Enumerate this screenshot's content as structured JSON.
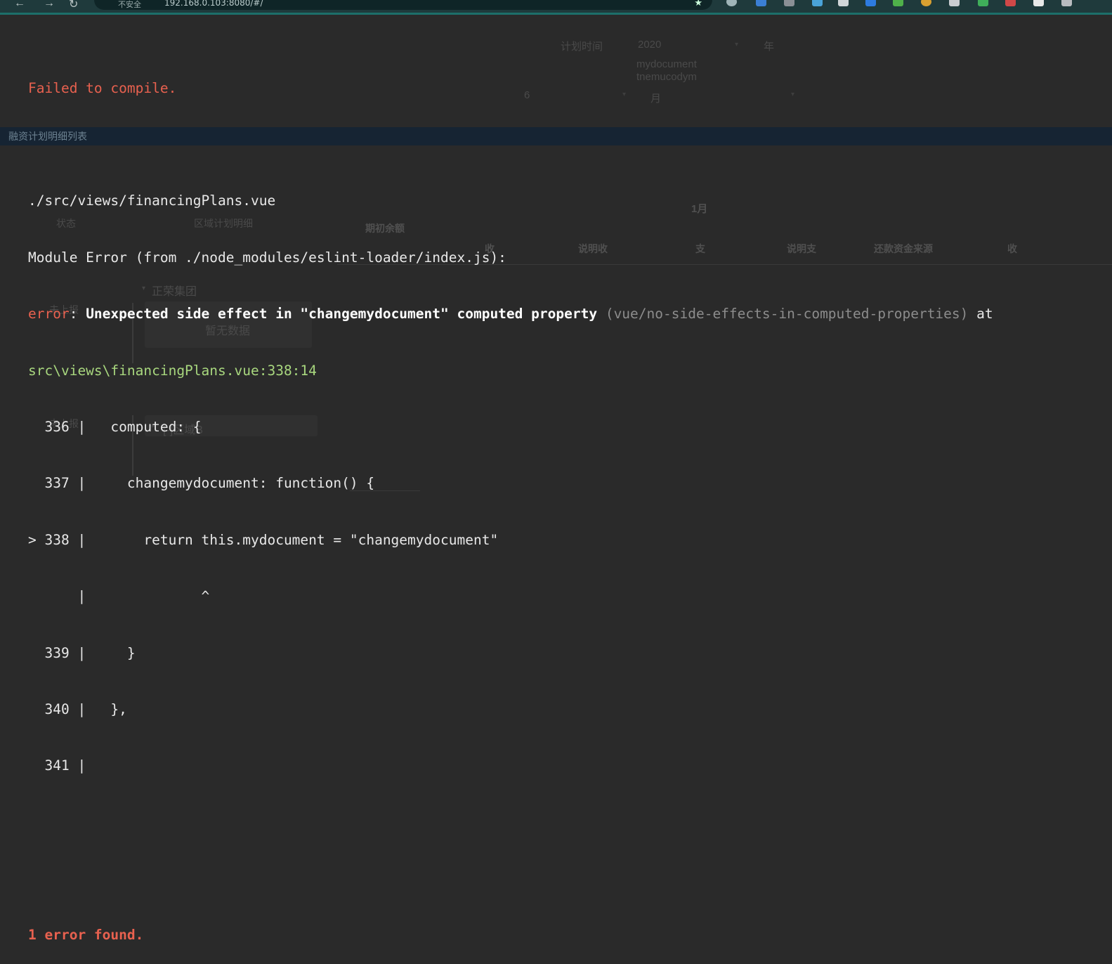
{
  "browser": {
    "security_label": "不安全",
    "url": "192.168.0.103:8080/#/",
    "back_icon": "arrow-left-icon",
    "forward_icon": "arrow-right-icon",
    "reload_icon": "reload-icon",
    "bookmark_icon": "star-icon",
    "theme_color": "#1f3a3c"
  },
  "background_app": {
    "plan_time_label": "计划时间",
    "year_value": "2020",
    "year_unit": "年",
    "doc_text": "mydocument",
    "doc_text_reversed": "tnemucodym",
    "month_value": "6",
    "month_unit": "月",
    "list_title": "融资计划明细列表",
    "status_header": "状态",
    "region_detail_header": "区域计划明细",
    "month_header": "1月",
    "opening_balance": "期初余额",
    "columns": [
      "收",
      "说明收",
      "支",
      "说明支",
      "还款资金来源",
      "收"
    ],
    "group_name": "正荣集团",
    "status_1": "未上报",
    "empty_text": "暂无数据",
    "status_2": "未上报",
    "region_b": "[-]区域B"
  },
  "error_overlay": {
    "title": "Failed to compile.",
    "file": "./src/views/financingPlans.vue",
    "module_error": "Module Error (from ./node_modules/eslint-loader/index.js):",
    "error_keyword": "error",
    "error_sep": ": ",
    "error_message": "Unexpected side effect in \"changemydocument\" computed property",
    "rule": "(vue/no-side-effects-in-computed-properties)",
    "at_word": " at",
    "location": "src\\views\\financingPlans.vue:338:14",
    "code_lines": [
      "  336 |   computed: {",
      "  337 |     changemydocument: function() {",
      "> 338 |       return this.mydocument = \"changemydocument\"",
      "      |              ^",
      "  339 |     }",
      "  340 |   },",
      "  341 |"
    ],
    "summary": "1 error found.",
    "colors": {
      "error": "#e8614f",
      "path": "#a8d77e",
      "rule": "#8c8c8c",
      "text": "#e8e8e8"
    }
  }
}
